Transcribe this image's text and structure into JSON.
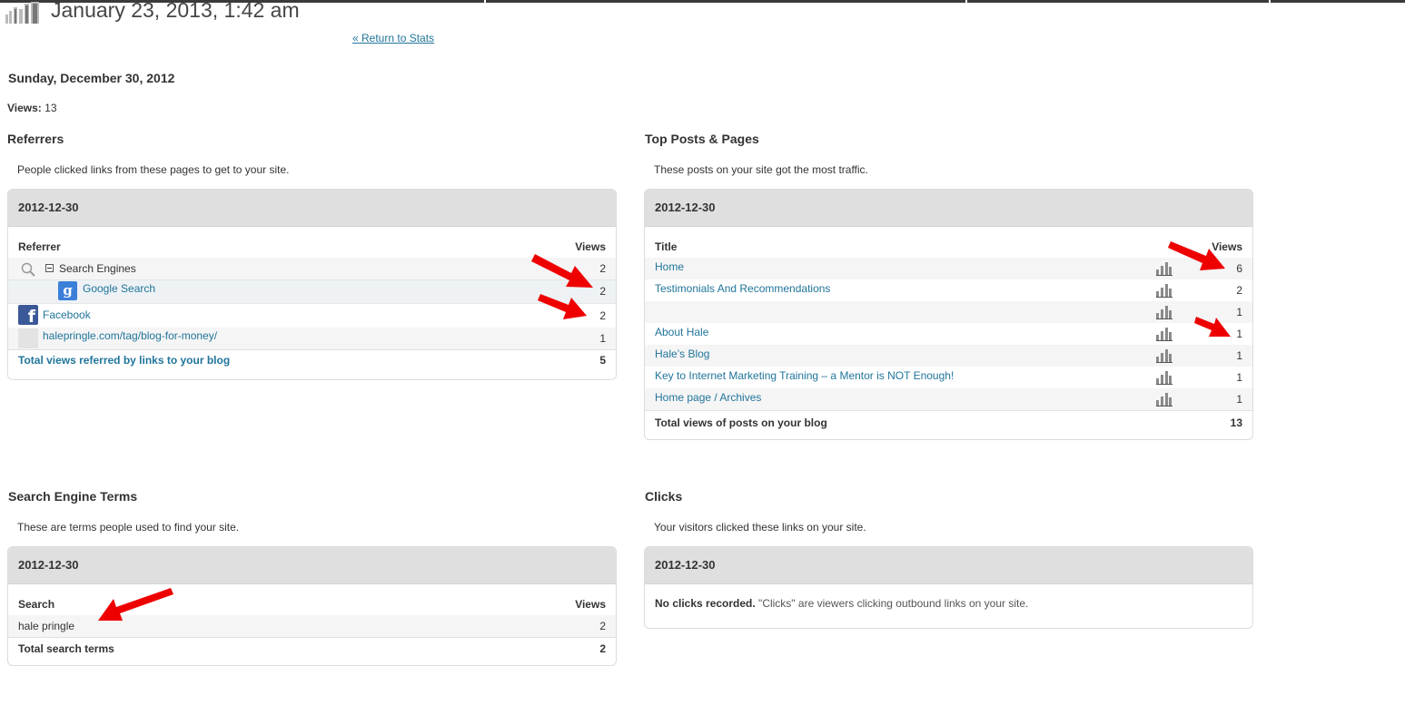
{
  "colors": {
    "link": "#21759b",
    "arrow": "#ee0000",
    "header_bg": "#dfdfdf"
  },
  "page": {
    "title": "January 23, 2013, 1:42 am",
    "return_link": "« Return to Stats",
    "date_heading": "Sunday, December 30, 2012",
    "views_label": "Views:",
    "views_value": "13"
  },
  "referrers": {
    "title": "Referrers",
    "description": "People clicked links from these pages to get to your site.",
    "date": "2012-12-30",
    "col_referrer": "Referrer",
    "col_views": "Views",
    "rows": [
      {
        "label": "Search Engines",
        "views": "2",
        "icon": "magnifier-icon"
      },
      {
        "label": "Google Search",
        "views": "2",
        "icon": "google-icon"
      },
      {
        "label": "Facebook",
        "views": "2",
        "icon": "facebook-icon"
      },
      {
        "label": "halepringle.com/tag/blog-for-money/",
        "views": "1",
        "icon": "blank-favicon"
      }
    ],
    "total_label": "Total views referred by links to your blog",
    "total_value": "5"
  },
  "top_posts": {
    "title": "Top Posts & Pages",
    "description": "These posts on your site got the most traffic.",
    "date": "2012-12-30",
    "col_title": "Title",
    "col_views": "Views",
    "rows": [
      {
        "label": "Home",
        "views": "6"
      },
      {
        "label": "Testimonials And Recommendations",
        "views": "2"
      },
      {
        "label": "",
        "views": "1"
      },
      {
        "label": "About Hale",
        "views": "1"
      },
      {
        "label": "Hale’s Blog",
        "views": "1"
      },
      {
        "label": "Key to Internet Marketing Training – a Mentor is NOT Enough!",
        "views": "1"
      },
      {
        "label": "Home page / Archives",
        "views": "1"
      }
    ],
    "total_label": "Total views of posts on your blog",
    "total_value": "13"
  },
  "search_terms": {
    "title": "Search Engine Terms",
    "description": "These are terms people used to find your site.",
    "date": "2012-12-30",
    "col_search": "Search",
    "col_views": "Views",
    "rows": [
      {
        "label": "hale pringle",
        "views": "2"
      }
    ],
    "total_label": "Total search terms",
    "total_value": "2"
  },
  "clicks": {
    "title": "Clicks",
    "description": "Your visitors clicked these links on your site.",
    "date": "2012-12-30",
    "none_bold": "No clicks recorded.",
    "none_text": " \"Clicks\" are viewers clicking outbound links on your site."
  }
}
